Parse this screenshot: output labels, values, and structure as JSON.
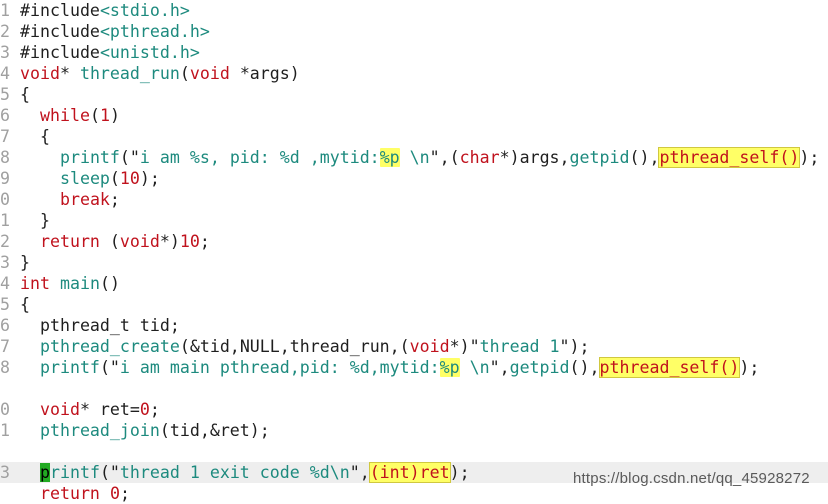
{
  "editor": {
    "lines": [
      {
        "ln": "1",
        "tokens": [
          {
            "t": "#include",
            "c": "pre"
          },
          {
            "t": "<stdio.h>",
            "c": "hdr"
          }
        ]
      },
      {
        "ln": "2",
        "tokens": [
          {
            "t": "#include",
            "c": "pre"
          },
          {
            "t": "<pthread.h>",
            "c": "hdr"
          }
        ]
      },
      {
        "ln": "3",
        "tokens": [
          {
            "t": "#include",
            "c": "pre"
          },
          {
            "t": "<unistd.h>",
            "c": "hdr"
          }
        ]
      },
      {
        "ln": "4",
        "tokens": [
          {
            "t": "void",
            "c": "keyword"
          },
          {
            "t": "* ",
            "c": "normal"
          },
          {
            "t": "thread_run",
            "c": "fn"
          },
          {
            "t": "(",
            "c": "normal"
          },
          {
            "t": "void",
            "c": "keyword"
          },
          {
            "t": " *args)",
            "c": "normal"
          }
        ]
      },
      {
        "ln": "5",
        "tokens": [
          {
            "t": "{",
            "c": "normal"
          }
        ]
      },
      {
        "ln": "6",
        "tokens": [
          {
            "t": "  ",
            "c": "normal"
          },
          {
            "t": "while",
            "c": "keyword"
          },
          {
            "t": "(",
            "c": "normal"
          },
          {
            "t": "1",
            "c": "num"
          },
          {
            "t": ")",
            "c": "normal"
          }
        ]
      },
      {
        "ln": "7",
        "tokens": [
          {
            "t": "  {",
            "c": "normal"
          }
        ]
      },
      {
        "ln": "8",
        "tokens": [
          {
            "t": "    ",
            "c": "normal"
          },
          {
            "t": "printf",
            "c": "fn"
          },
          {
            "t": "(\"",
            "c": "normal"
          },
          {
            "t": "i am %s, pid: %d ,mytid:",
            "c": "str"
          },
          {
            "t": "%p",
            "c": "str hl"
          },
          {
            "t": " \\n",
            "c": "str"
          },
          {
            "t": "\",(",
            "c": "normal"
          },
          {
            "t": "char",
            "c": "keyword"
          },
          {
            "t": "*)args,",
            "c": "normal"
          },
          {
            "t": "getpid",
            "c": "fn"
          },
          {
            "t": "(),",
            "c": "normal"
          },
          {
            "t": "pthread_self()",
            "c": "keyword hlsel"
          },
          {
            "t": ");",
            "c": "normal"
          }
        ]
      },
      {
        "ln": "9",
        "tokens": [
          {
            "t": "    ",
            "c": "normal"
          },
          {
            "t": "sleep",
            "c": "fn"
          },
          {
            "t": "(",
            "c": "normal"
          },
          {
            "t": "10",
            "c": "num"
          },
          {
            "t": ");",
            "c": "normal"
          }
        ]
      },
      {
        "ln": "0",
        "tokens": [
          {
            "t": "    ",
            "c": "normal"
          },
          {
            "t": "break",
            "c": "keyword"
          },
          {
            "t": ";",
            "c": "normal"
          }
        ]
      },
      {
        "ln": "1",
        "tokens": [
          {
            "t": "  }",
            "c": "normal"
          }
        ]
      },
      {
        "ln": "2",
        "tokens": [
          {
            "t": "  ",
            "c": "normal"
          },
          {
            "t": "return",
            "c": "keyword"
          },
          {
            "t": " (",
            "c": "normal"
          },
          {
            "t": "void",
            "c": "keyword"
          },
          {
            "t": "*)",
            "c": "normal"
          },
          {
            "t": "10",
            "c": "num"
          },
          {
            "t": ";",
            "c": "normal"
          }
        ]
      },
      {
        "ln": "3",
        "tokens": [
          {
            "t": "}",
            "c": "normal"
          }
        ]
      },
      {
        "ln": "4",
        "tokens": [
          {
            "t": "int",
            "c": "keyword"
          },
          {
            "t": " ",
            "c": "normal"
          },
          {
            "t": "main",
            "c": "fn"
          },
          {
            "t": "()",
            "c": "normal"
          }
        ]
      },
      {
        "ln": "5",
        "tokens": [
          {
            "t": "{",
            "c": "normal"
          }
        ]
      },
      {
        "ln": "6",
        "tokens": [
          {
            "t": "  pthread_t tid;",
            "c": "normal"
          }
        ]
      },
      {
        "ln": "7",
        "tokens": [
          {
            "t": "  ",
            "c": "normal"
          },
          {
            "t": "pthread_create",
            "c": "fn"
          },
          {
            "t": "(&tid,",
            "c": "normal"
          },
          {
            "t": "NULL",
            "c": "const"
          },
          {
            "t": ",thread_run,(",
            "c": "normal"
          },
          {
            "t": "void",
            "c": "keyword"
          },
          {
            "t": "*)\"",
            "c": "normal"
          },
          {
            "t": "thread 1",
            "c": "str"
          },
          {
            "t": "\");",
            "c": "normal"
          }
        ]
      },
      {
        "ln": "8",
        "tokens": [
          {
            "t": "  ",
            "c": "normal"
          },
          {
            "t": "printf",
            "c": "fn"
          },
          {
            "t": "(\"",
            "c": "normal"
          },
          {
            "t": "i am main pthread,pid: %d,mytid:",
            "c": "str"
          },
          {
            "t": "%p",
            "c": "str hl"
          },
          {
            "t": " \\n",
            "c": "str"
          },
          {
            "t": "\",",
            "c": "normal"
          },
          {
            "t": "getpid",
            "c": "fn"
          },
          {
            "t": "(),",
            "c": "normal"
          },
          {
            "t": "pthread_self()",
            "c": "keyword hlsel"
          },
          {
            "t": ");",
            "c": "normal"
          }
        ]
      },
      {
        "ln": "",
        "tokens": []
      },
      {
        "ln": "0",
        "tokens": [
          {
            "t": "  ",
            "c": "normal"
          },
          {
            "t": "void",
            "c": "keyword"
          },
          {
            "t": "* ret=",
            "c": "normal"
          },
          {
            "t": "0",
            "c": "num"
          },
          {
            "t": ";",
            "c": "normal"
          }
        ]
      },
      {
        "ln": "1",
        "tokens": [
          {
            "t": "  ",
            "c": "normal"
          },
          {
            "t": "pthread_join",
            "c": "fn"
          },
          {
            "t": "(tid,&ret);",
            "c": "normal"
          }
        ]
      },
      {
        "ln": "",
        "tokens": []
      },
      {
        "ln": "3",
        "cursorline": true,
        "tokens": [
          {
            "t": "  ",
            "c": "normal"
          },
          {
            "t": "p",
            "c": "fn cursor"
          },
          {
            "t": "rintf",
            "c": "fn"
          },
          {
            "t": "(\"",
            "c": "normal"
          },
          {
            "t": "thread 1 exit code %d\\n",
            "c": "str"
          },
          {
            "t": "\",",
            "c": "normal"
          },
          {
            "t": "(int)ret",
            "c": "keyword hlsel"
          },
          {
            "t": ");",
            "c": "normal"
          }
        ]
      },
      {
        "ln": "",
        "tokens": [
          {
            "t": "  ",
            "c": "normal"
          },
          {
            "t": "return",
            "c": "keyword"
          },
          {
            "t": " ",
            "c": "normal"
          },
          {
            "t": "0",
            "c": "num"
          },
          {
            "t": ";",
            "c": "normal"
          }
        ]
      }
    ]
  },
  "watermark": {
    "text": "https://blog.csdn.net/qq_45928272"
  }
}
